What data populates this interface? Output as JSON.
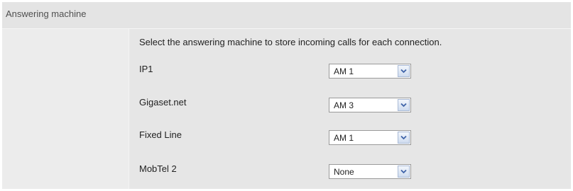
{
  "section": {
    "title": "Answering machine"
  },
  "intro_text": "Select the answering machine to store incoming calls for each connection.",
  "connections": [
    {
      "label": "IP1",
      "selected": "AM 1"
    },
    {
      "label": "Gigaset.net",
      "selected": "AM 3"
    },
    {
      "label": "Fixed Line",
      "selected": "AM 1"
    },
    {
      "label": "MobTel 2",
      "selected": "None"
    }
  ],
  "icons": {
    "dropdown": "chevron-down-icon"
  },
  "colors": {
    "background": "#e6e6e6",
    "dropdown_button": "#cfdcef",
    "chevron": "#3e63a8"
  }
}
